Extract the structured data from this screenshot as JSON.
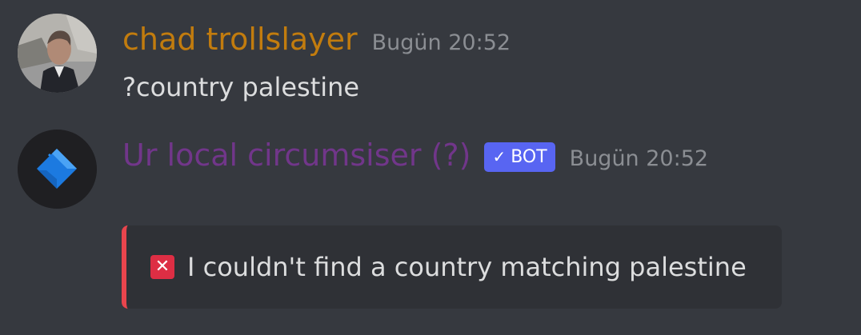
{
  "messages": [
    {
      "author": "chad trollslayer",
      "timestamp": "Bugün 20:52",
      "content": "?country palestine",
      "author_color": "#c27c0e"
    },
    {
      "author": "Ur local circumsiser (?)",
      "badge": "BOT",
      "badge_check": "✓",
      "timestamp": "Bugün 20:52",
      "author_color": "#71368a",
      "embed": {
        "icon": "x-mark-icon",
        "icon_glyph": "✕",
        "text": "I couldn't find a country matching palestine",
        "border_color": "#e9454d"
      }
    }
  ]
}
